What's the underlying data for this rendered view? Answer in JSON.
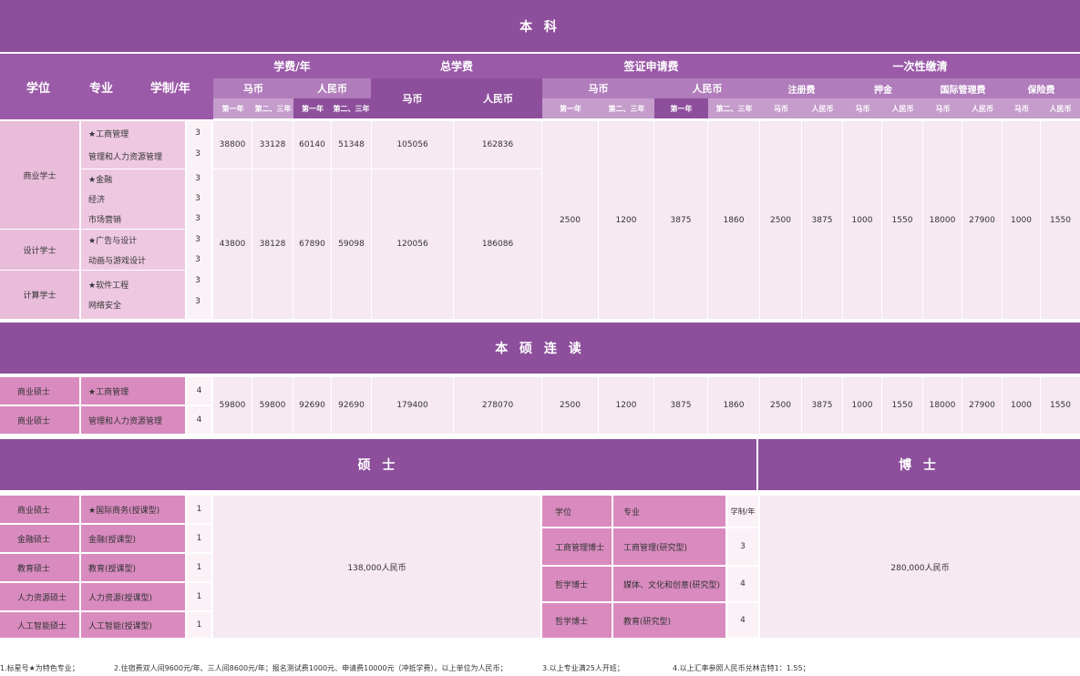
{
  "sections": {
    "undergrad": "本 科",
    "combined": "本 硕 连 读",
    "master": "硕 士",
    "phd": "博 士"
  },
  "header": {
    "degree": "学位",
    "major": "专业",
    "duration": "学制/年",
    "tuition": "学费/年",
    "total_tuition": "总学费",
    "visa_fee": "签证申请费",
    "one_time": "一次性缴清",
    "myr": "马币",
    "rmb": "人民币",
    "year1": "第一年",
    "year23": "第二、三年",
    "registration": "注册费",
    "deposit": "押金",
    "intl_admin": "国际管理费",
    "insurance": "保险费"
  },
  "undergrad": {
    "degrees": [
      "商业学士",
      "设计学士",
      "计算学士"
    ],
    "majors": [
      "★工商管理",
      "管理和人力资源管理",
      "★金融",
      "经济",
      "市场营销",
      "★广告与设计",
      "动画与游戏设计",
      "★软件工程",
      "网络安全"
    ],
    "durations": [
      "3",
      "3",
      "3",
      "3",
      "3",
      "3",
      "3",
      "3",
      "3"
    ],
    "row_a": {
      "myr_y1": "38800",
      "myr_y23": "33128",
      "rmb_y1": "60140",
      "rmb_y23": "51348",
      "total_myr": "105056",
      "total_rmb": "162836"
    },
    "row_b": {
      "myr_y1": "43800",
      "myr_y23": "38128",
      "rmb_y1": "67890",
      "rmb_y23": "59098",
      "total_myr": "120056",
      "total_rmb": "186086"
    },
    "fees": [
      "2500",
      "1200",
      "3875",
      "1860",
      "2500",
      "3875",
      "1000",
      "1550",
      "18000",
      "27900",
      "1000",
      "1550"
    ]
  },
  "combined": {
    "degrees": [
      "商业硕士",
      "商业硕士"
    ],
    "majors": [
      "★工商管理",
      "管理和人力资源管理"
    ],
    "durations": [
      "4",
      "4"
    ],
    "tuition": {
      "myr_y1": "59800",
      "myr_y23": "59800",
      "rmb_y1": "92690",
      "rmb_y23": "92690",
      "total_myr": "179400",
      "total_rmb": "278070"
    },
    "fees": [
      "2500",
      "1200",
      "3875",
      "1860",
      "2500",
      "3875",
      "1000",
      "1550",
      "18000",
      "27900",
      "1000",
      "1550"
    ]
  },
  "master": {
    "degrees": [
      "商业硕士",
      "金融硕士",
      "教育硕士",
      "人力资源硕士",
      "人工智能硕士"
    ],
    "majors": [
      "★国际商务(授课型)",
      "金融(授课型)",
      "教育(授课型)",
      "人力资源(授课型)",
      "人工智能(授课型)"
    ],
    "durations": [
      "1",
      "1",
      "1",
      "1",
      "1"
    ],
    "price": "138,000人民币"
  },
  "phd": {
    "col_degree": "学位",
    "col_major": "专业",
    "col_duration": "学制/年",
    "degrees": [
      "工商管理博士",
      "哲学博士",
      "哲学博士"
    ],
    "majors": [
      "工商管理(研究型)",
      "媒体、文化和创意(研究型)",
      "教育(研究型)"
    ],
    "durations": [
      "3",
      "4",
      "4"
    ],
    "price": "280,000人民币"
  },
  "notes": [
    "1.标星号★为特色专业；",
    "2.住宿费双人间9600元/年、三人间8600元/年；报名测试费1000元、申请费10000元（冲抵学费）。以上单位为人民币；",
    "3.以上专业满25人开班；",
    "4.以上汇率参照人民币兑林吉特1：1.55；"
  ],
  "colors": {
    "band": "#8d4f9c",
    "header": "#9b5aa8",
    "light": "#f6e9f2"
  }
}
